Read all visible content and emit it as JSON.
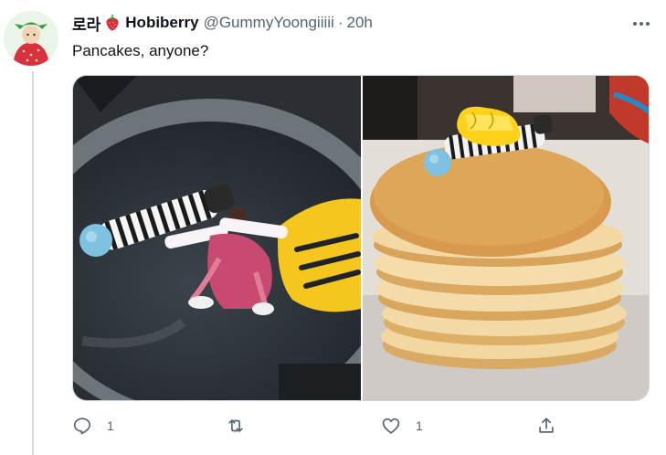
{
  "tweet": {
    "author": {
      "korean_name": "로라",
      "name": "Hobiberry",
      "handle": "@GummyYoongiiiii",
      "avatar_icon": "strawberry-costume-avatar"
    },
    "separator": "·",
    "time": "20h",
    "text": "Pancakes, anyone?",
    "media": [
      {
        "icon": "photo-frying-pan-with-tiny-people"
      },
      {
        "icon": "photo-pancake-stack-with-butter"
      }
    ],
    "actions": {
      "reply_count": "1",
      "retweet_count": "",
      "like_count": "1"
    }
  },
  "colors": {
    "secondary_text": "#536471",
    "border": "#cfd9de",
    "primary_text": "#0f1419"
  }
}
